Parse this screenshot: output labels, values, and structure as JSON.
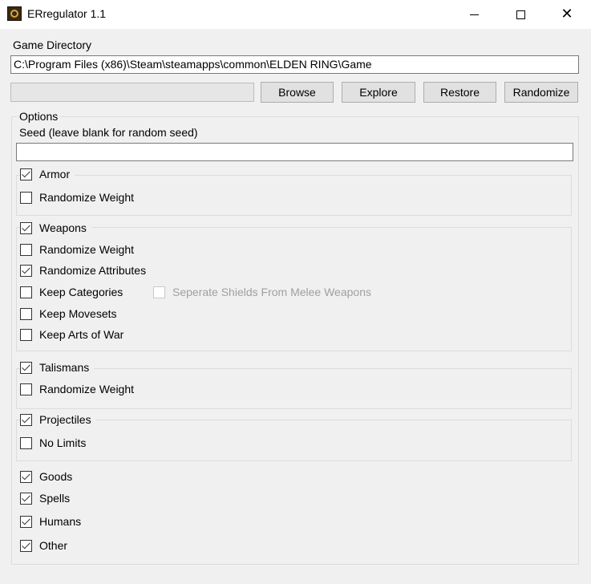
{
  "window": {
    "title": "ERregulator 1.1"
  },
  "game_directory": {
    "label": "Game Directory",
    "value": "C:\\Program Files (x86)\\Steam\\steamapps\\common\\ELDEN RING\\Game"
  },
  "buttons": {
    "browse": "Browse",
    "explore": "Explore",
    "restore": "Restore",
    "randomize": "Randomize"
  },
  "options": {
    "legend": "Options",
    "seed_label": "Seed (leave blank for random seed)",
    "seed_value": "",
    "armor": {
      "label": "Armor",
      "checked": true,
      "randomize_weight": {
        "label": "Randomize Weight",
        "checked": false
      }
    },
    "weapons": {
      "label": "Weapons",
      "checked": true,
      "randomize_weight": {
        "label": "Randomize Weight",
        "checked": false
      },
      "randomize_attributes": {
        "label": "Randomize Attributes",
        "checked": true
      },
      "keep_categories": {
        "label": "Keep Categories",
        "checked": false
      },
      "separate_shields": {
        "label": "Seperate Shields From Melee Weapons",
        "checked": false
      },
      "keep_movesets": {
        "label": "Keep Movesets",
        "checked": false
      },
      "keep_arts_of_war": {
        "label": "Keep Arts of War",
        "checked": false
      }
    },
    "talismans": {
      "label": "Talismans",
      "checked": true,
      "randomize_weight": {
        "label": "Randomize Weight",
        "checked": false
      }
    },
    "projectiles": {
      "label": "Projectiles",
      "checked": true,
      "no_limits": {
        "label": "No Limits",
        "checked": false
      }
    },
    "goods": {
      "label": "Goods",
      "checked": true
    },
    "spells": {
      "label": "Spells",
      "checked": true
    },
    "humans": {
      "label": "Humans",
      "checked": true
    },
    "other": {
      "label": "Other",
      "checked": true
    }
  }
}
